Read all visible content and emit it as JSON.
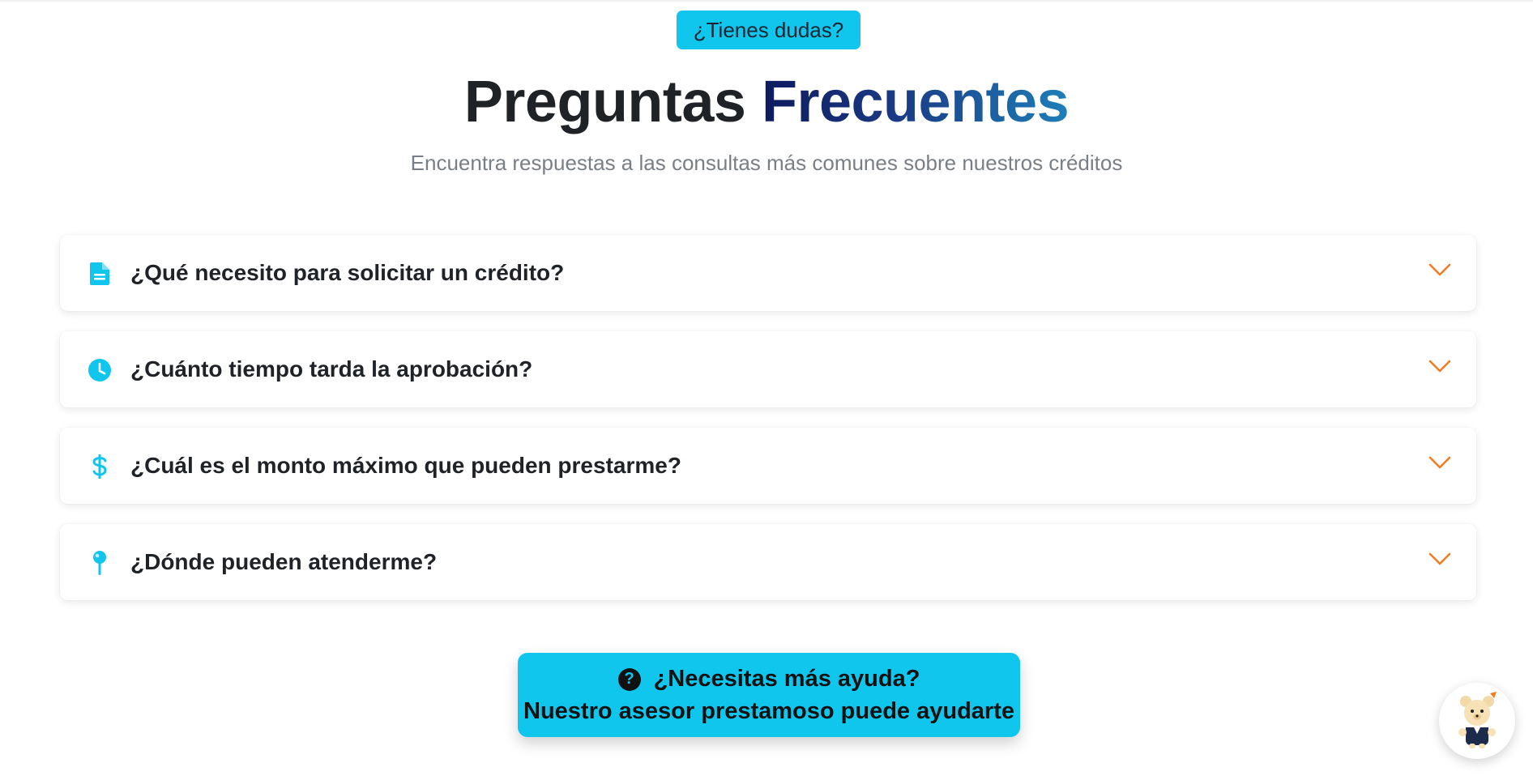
{
  "header": {
    "badge": "¿Tienes dudas?",
    "title_part1": "Preguntas ",
    "title_part2": "Frecuentes",
    "subtitle": "Encuentra respuestas a las consultas más comunes sobre nuestros créditos"
  },
  "faq": [
    {
      "icon": "document-icon",
      "question": "¿Qué necesito para solicitar un crédito?"
    },
    {
      "icon": "clock-icon",
      "question": "¿Cuánto tiempo tarda la aprobación?"
    },
    {
      "icon": "dollar-icon",
      "question": "¿Cuál es el monto máximo que pueden prestarme?"
    },
    {
      "icon": "map-pin-icon",
      "question": "¿Dónde pueden atenderme?"
    }
  ],
  "help": {
    "line1": "¿Necesitas más ayuda?",
    "line2": "Nuestro asesor prestamoso puede ayudarte",
    "icon": "question-circle-icon"
  },
  "chat": {
    "icon": "mascot-avatar"
  },
  "colors": {
    "accent": "#10c6ec",
    "chevron": "#f47a20",
    "title_gradient": [
      "#0d1b5e",
      "#1e7fb8"
    ]
  }
}
